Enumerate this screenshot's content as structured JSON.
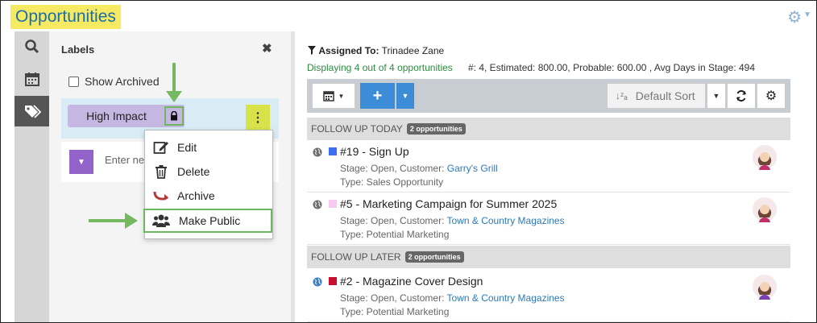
{
  "header": {
    "title": "Opportunities"
  },
  "labels_panel": {
    "title": "Labels",
    "show_archived": "Show Archived",
    "label_name": "High Impact",
    "new_label_placeholder": "Enter ne"
  },
  "context_menu": {
    "items": [
      {
        "label": "Edit",
        "icon": "edit-icon"
      },
      {
        "label": "Delete",
        "icon": "trash-icon"
      },
      {
        "label": "Archive",
        "icon": "archive-arrow-icon"
      },
      {
        "label": "Make Public",
        "icon": "users-icon"
      }
    ]
  },
  "main": {
    "assigned_label": "Assigned To:",
    "assigned_value": "Trinadee Zane",
    "display_count": "Displaying 4 out of 4 opportunities",
    "stats": "#: 4, Estimated: 800.00, Probable: 600.00 , Avg Days in Stage: 494",
    "sort_label": "Default Sort",
    "sections": [
      {
        "title": "FOLLOW UP TODAY",
        "badge": "2 opportunities"
      },
      {
        "title": "FOLLOW UP LATER",
        "badge": "2 opportunities"
      }
    ],
    "opportunities": [
      {
        "title": "#19 - Sign Up",
        "stage_prefix": "Stage: Open, Customer: ",
        "customer": "Garry's Grill",
        "type": "Type: Sales Opportunity",
        "color": "#3d6df2"
      },
      {
        "title": "#5 - Marketing Campaign for Summer 2025",
        "stage_prefix": "Stage: Open, Customer: ",
        "customer": "Town & Country Magazines",
        "type": "Type: Potential Marketing",
        "color": "#f7c9f0"
      },
      {
        "title": "#2 - Magazine Cover Design",
        "stage_prefix": "Stage: Open, Customer: ",
        "customer": "Town & Country Magazines",
        "type": "Type: Potential Marketing",
        "color": "#c8102e"
      }
    ]
  },
  "colors": {
    "title_highlight": "#f6ea63",
    "title_text": "#1b6fa8",
    "label_pill": "#c6b7e2",
    "kebab": "#d8e34a",
    "accent_green": "#74b95f",
    "primary_blue": "#3c8cd8"
  }
}
